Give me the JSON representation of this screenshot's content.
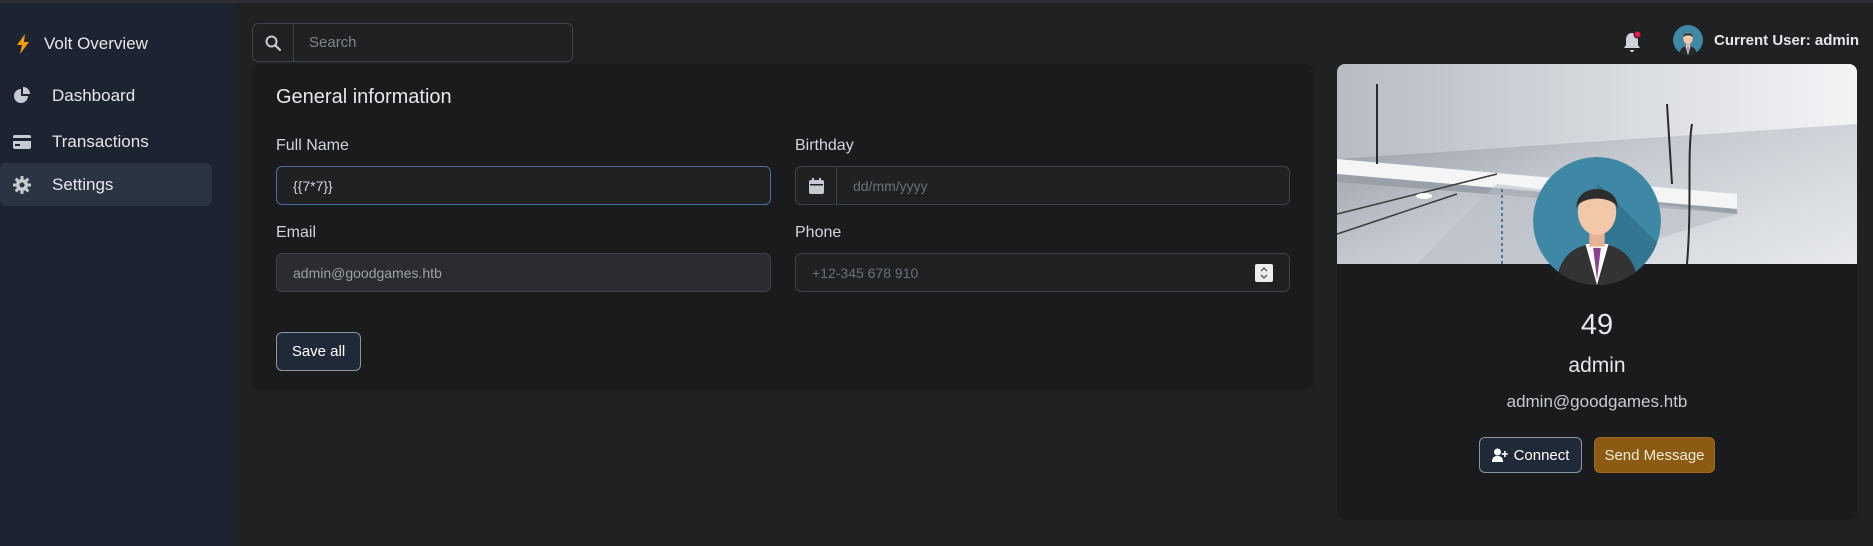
{
  "sidebar": {
    "brand": {
      "label": "Volt Overview",
      "icon": "bolt-icon"
    },
    "items": [
      {
        "label": "Dashboard",
        "icon": "pie-chart-icon",
        "active": false
      },
      {
        "label": "Transactions",
        "icon": "credit-card-icon",
        "active": false
      },
      {
        "label": "Settings",
        "icon": "gear-icon",
        "active": true
      }
    ]
  },
  "topbar": {
    "search": {
      "placeholder": "Search",
      "value": ""
    },
    "notification_icon": "bell-icon",
    "user_label": "Current User: admin"
  },
  "general_info": {
    "title": "General information",
    "full_name": {
      "label": "Full Name",
      "value": "{{7*7}}"
    },
    "birthday": {
      "label": "Birthday",
      "placeholder": "dd/mm/yyyy",
      "value": ""
    },
    "email": {
      "label": "Email",
      "value": "admin@goodgames.htb"
    },
    "phone": {
      "label": "Phone",
      "placeholder": "+12-345 678 910",
      "value": ""
    },
    "save_label": "Save all"
  },
  "profile": {
    "number": "49",
    "name": "admin",
    "email": "admin@goodgames.htb",
    "connect_label": "Connect",
    "message_label": "Send Message"
  },
  "colors": {
    "background": "#1f2123",
    "sidebar": "#1c2331",
    "card": "#1a1b1d",
    "accent_gold": "#8b5a13",
    "notification_dot": "#e11d48"
  }
}
